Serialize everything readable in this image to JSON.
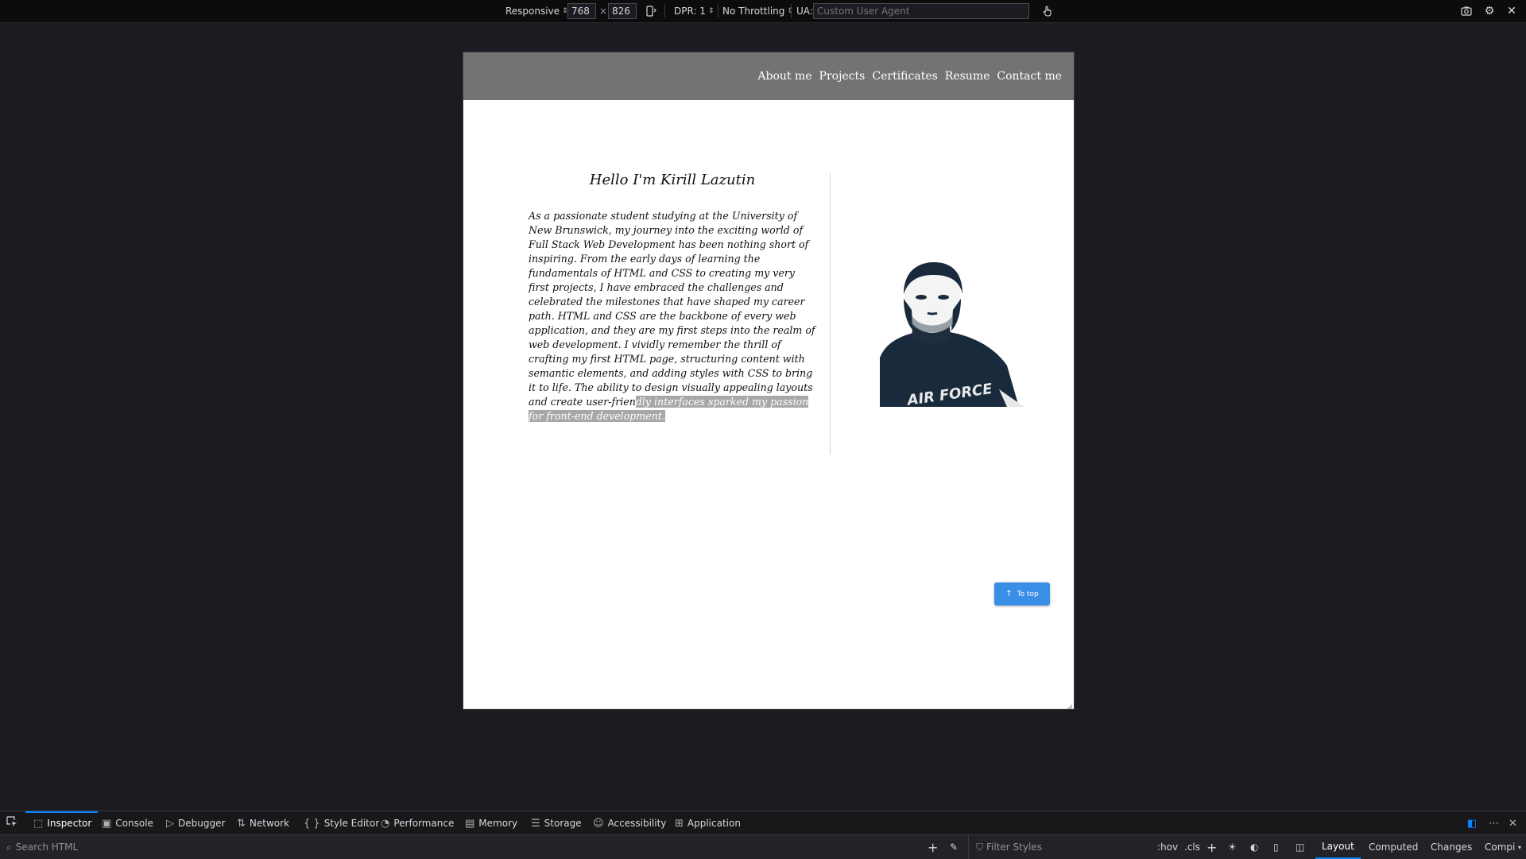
{
  "toolbar": {
    "device": "Responsive",
    "width": "768",
    "times": "×",
    "height": "826",
    "dpr": "DPR: 1",
    "throttling": "No Throttling",
    "ua_label": "UA:",
    "ua_placeholder": "Custom User Agent"
  },
  "site": {
    "nav": [
      "About me",
      "Projects",
      "Certificates",
      "Resume",
      "Contact me"
    ],
    "heading": "Hello I'm Kirill Lazutin",
    "paragraph_main": "As a passionate student studying at the University of New Brunswick, my journey into the exciting world of Full Stack Web Development has been nothing short of inspiring. From the early days of learning the fundamentals of HTML and CSS to creating my very first projects, I have embraced the challenges and celebrated the milestones that have shaped my career path. HTML and CSS are the backbone of every web application, and they are my first steps into the realm of web development. I vividly remember the thrill of crafting my first HTML page, structuring content with semantic elements, and adding styles with CSS to bring it to life. The ability to design visually appealing layouts and create user-frien",
    "paragraph_selected": "dly interfaces sparked my passion for front-end development.",
    "to_top": "To top",
    "portrait_text": "AIR FORCE"
  },
  "devtools": {
    "tabs": [
      "Inspector",
      "Console",
      "Debugger",
      "Network",
      "Style Editor",
      "Performance",
      "Memory",
      "Storage",
      "Accessibility",
      "Application"
    ],
    "search_placeholder": "Search HTML",
    "filter_placeholder": "Filter Styles",
    "hov": ":hov",
    "cls": ".cls",
    "side_tabs": [
      "Layout",
      "Computed",
      "Changes",
      "Compi"
    ]
  },
  "colors": {
    "accent": "#0a84ff",
    "nav_bg": "#737373",
    "button_bg": "#3a8ee6",
    "selection": "#a7a7a7"
  }
}
